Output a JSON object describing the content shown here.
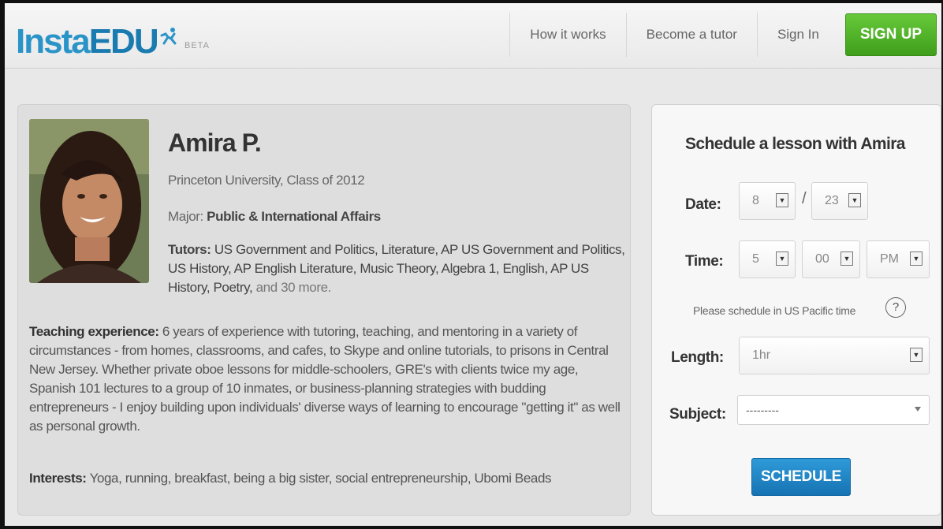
{
  "header": {
    "logo_insta": "Insta",
    "logo_edu": "EDU",
    "beta": "BETA",
    "nav": {
      "how_it_works": "How it works",
      "become_tutor": "Become a tutor",
      "sign_in": "Sign In",
      "sign_up": "SIGN UP"
    }
  },
  "profile": {
    "name": "Amira P.",
    "school": "Princeton University, Class of 2012",
    "major_label": "Major:",
    "major_value": "Public & International Affairs",
    "tutors_label": "Tutors:",
    "tutors_value": "US Government and Politics, Literature, AP US Government and Politics, US History, AP English Literature, Music Theory, Algebra 1, English, AP US History, Poetry,",
    "tutors_more": "and 30 more.",
    "teaching_label": "Teaching experience:",
    "teaching_value": "6 years of experience with tutoring, teaching, and mentoring in a variety of circumstances - from homes, classrooms, and cafes, to Skype and online tutorials, to prisons in Central New Jersey. Whether private oboe lessons for middle-schoolers, GRE's with clients twice my age, Spanish 101 lectures to a group of 10 inmates, or business-planning strategies with budding entrepreneurs - I enjoy building upon individuals' diverse ways of learning to encourage \"getting it\" as well as personal growth.",
    "interests_label": "Interests:",
    "interests_value": "Yoga, running, breakfast, being a big sister, social entrepreneurship, Ubomi Beads"
  },
  "schedule": {
    "title": "Schedule a lesson with Amira",
    "date_label": "Date:",
    "date_month": "8",
    "date_sep": "/",
    "date_day": "23",
    "time_label": "Time:",
    "time_hour": "5",
    "time_minute": "00",
    "time_ampm": "PM",
    "tz_note": "Please schedule in US Pacific time",
    "help": "?",
    "length_label": "Length:",
    "length_value": "1hr",
    "subject_label": "Subject:",
    "subject_value": "---------",
    "button": "SCHEDULE"
  },
  "icons": {
    "logo_mark": "running-figure-icon",
    "help": "question-circle-icon",
    "select_arrow": "chevron-down-icon"
  },
  "colors": {
    "brand_blue": "#2a94c8",
    "signup_green": "#4fb12a",
    "schedule_blue": "#1f86c6"
  }
}
